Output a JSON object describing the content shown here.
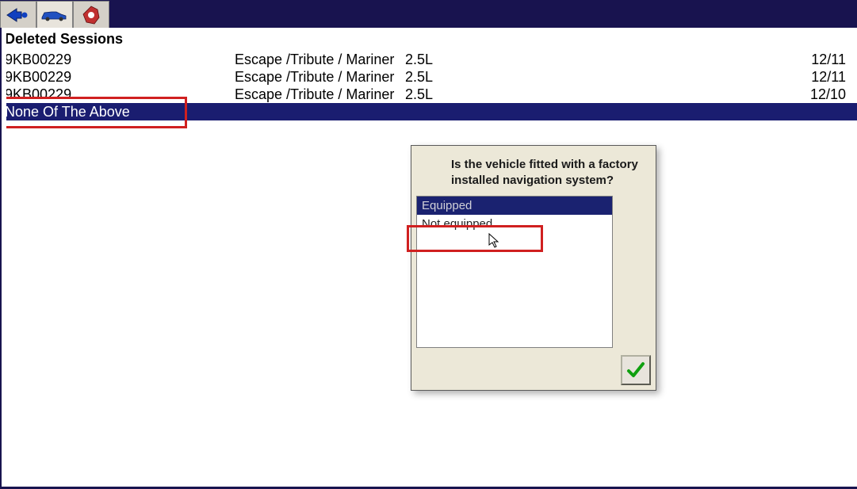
{
  "header": {
    "title": ""
  },
  "tabs": {
    "tab1": "back",
    "tab2": "vehicle",
    "tab3": "tools"
  },
  "sessions": {
    "header": "Deleted Sessions",
    "rows": [
      {
        "id": "9KB00229",
        "vehicle": "Escape /Tribute / Mariner",
        "engine": "2.5L",
        "date": "12/11"
      },
      {
        "id": "9KB00229",
        "vehicle": "Escape /Tribute / Mariner",
        "engine": "2.5L",
        "date": "12/11"
      },
      {
        "id": "9KB00229",
        "vehicle": "Escape /Tribute / Mariner",
        "engine": "2.5L",
        "date": "12/10"
      }
    ],
    "noneLabel": "None Of The Above"
  },
  "dialog": {
    "question": "Is the vehicle fitted with a factory installed navigation system?",
    "options": {
      "equipped": "Equipped",
      "notEquipped": "Not equipped"
    },
    "confirmLabel": "OK"
  }
}
